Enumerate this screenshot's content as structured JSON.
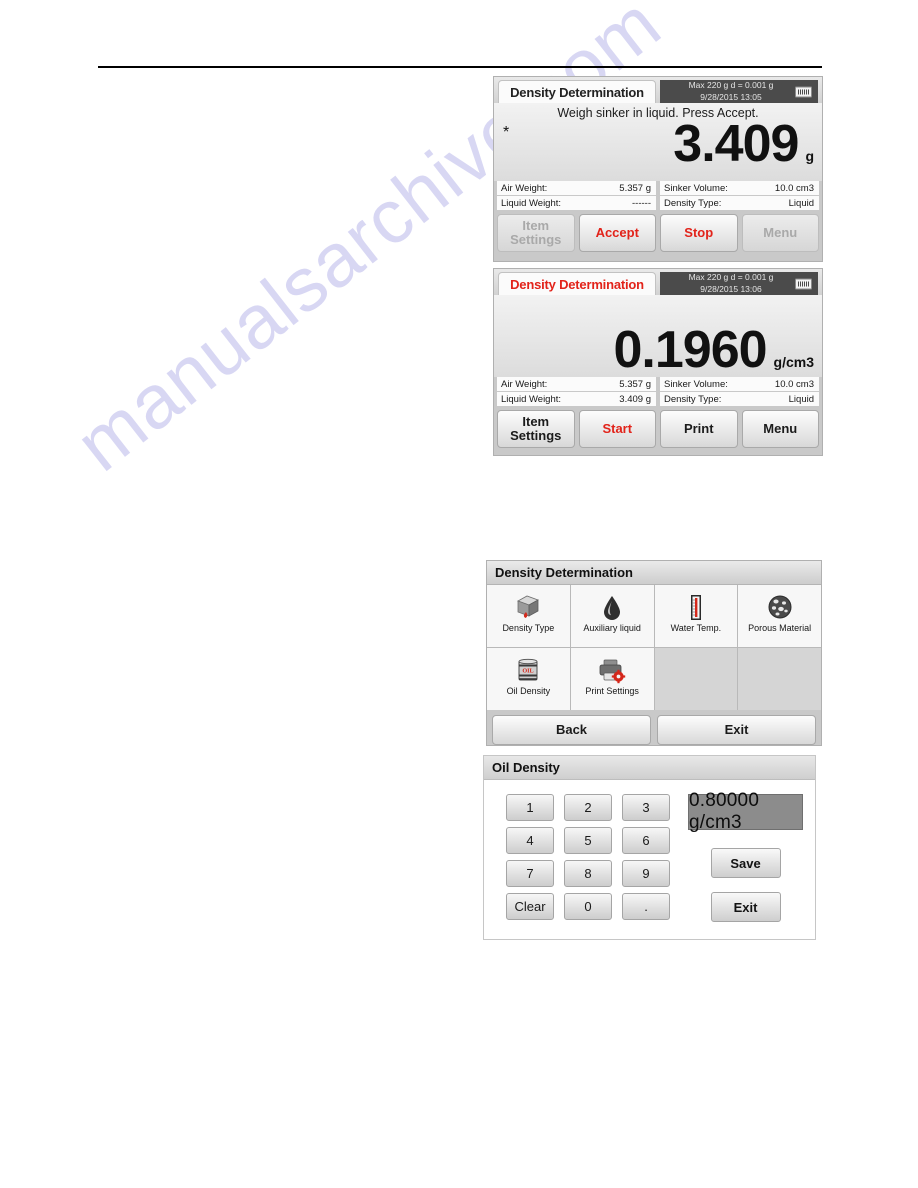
{
  "watermark": "manualsarchive.com",
  "screen1": {
    "app_title": "Density Determination",
    "status_line1": "Max 220 g   d = 0.001 g",
    "status_line2": "9/28/2015   13:05",
    "conn_icon": "printer-connector-icon",
    "instruction": "Weigh sinker in liquid. Press Accept.",
    "stability_marker": "*",
    "value": "3.409",
    "unit": "g",
    "info": [
      {
        "label": "Air Weight:",
        "value": "5.357 g"
      },
      {
        "label": "Sinker Volume:",
        "value": "10.0 cm3"
      },
      {
        "label": "Liquid Weight:",
        "value": "------"
      },
      {
        "label": "Density Type:",
        "value": "Liquid"
      }
    ],
    "buttons": [
      {
        "line1": "Item",
        "line2": "Settings",
        "state": "disabled"
      },
      {
        "line1": "Accept",
        "line2": "",
        "state": "red"
      },
      {
        "line1": "Stop",
        "line2": "",
        "state": "red"
      },
      {
        "line1": "Menu",
        "line2": "",
        "state": "disabled"
      }
    ]
  },
  "screen2": {
    "app_title": "Density Determination",
    "app_title_color": "#e2231a",
    "status_line1": "Max 220 g   d = 0.001 g",
    "status_line2": "9/28/2015   13:06",
    "conn_icon": "printer-connector-icon",
    "value": "0.1960",
    "unit": "g/cm3",
    "info": [
      {
        "label": "Air Weight:",
        "value": "5.357 g"
      },
      {
        "label": "Sinker Volume:",
        "value": "10.0 cm3"
      },
      {
        "label": "Liquid Weight:",
        "value": "3.409 g"
      },
      {
        "label": "Density Type:",
        "value": "Liquid"
      }
    ],
    "buttons": [
      {
        "line1": "Item",
        "line2": "Settings",
        "state": "normal"
      },
      {
        "line1": "Start",
        "line2": "",
        "state": "red"
      },
      {
        "line1": "Print",
        "line2": "",
        "state": "normal"
      },
      {
        "line1": "Menu",
        "line2": "",
        "state": "normal"
      }
    ]
  },
  "screen3": {
    "header": "Density Determination",
    "tiles": [
      {
        "label": "Density Type",
        "icon": "cube-with-droplet-icon"
      },
      {
        "label": "Auxiliary liquid",
        "icon": "droplet-icon"
      },
      {
        "label": "Water Temp.",
        "icon": "thermometer-icon"
      },
      {
        "label": "Porous Material",
        "icon": "porous-sphere-icon"
      },
      {
        "label": "Oil Density",
        "icon": "oil-barrel-icon"
      },
      {
        "label": "Print Settings",
        "icon": "printer-gear-icon"
      },
      {
        "label": "",
        "icon": ""
      },
      {
        "label": "",
        "icon": ""
      }
    ],
    "back_label": "Back",
    "exit_label": "Exit"
  },
  "screen4": {
    "header": "Oil Density",
    "keys": [
      "1",
      "2",
      "3",
      "4",
      "5",
      "6",
      "7",
      "8",
      "9",
      "Clear",
      "0",
      "."
    ],
    "value": "0.80000 g/cm3",
    "save_label": "Save",
    "exit_label": "Exit"
  }
}
